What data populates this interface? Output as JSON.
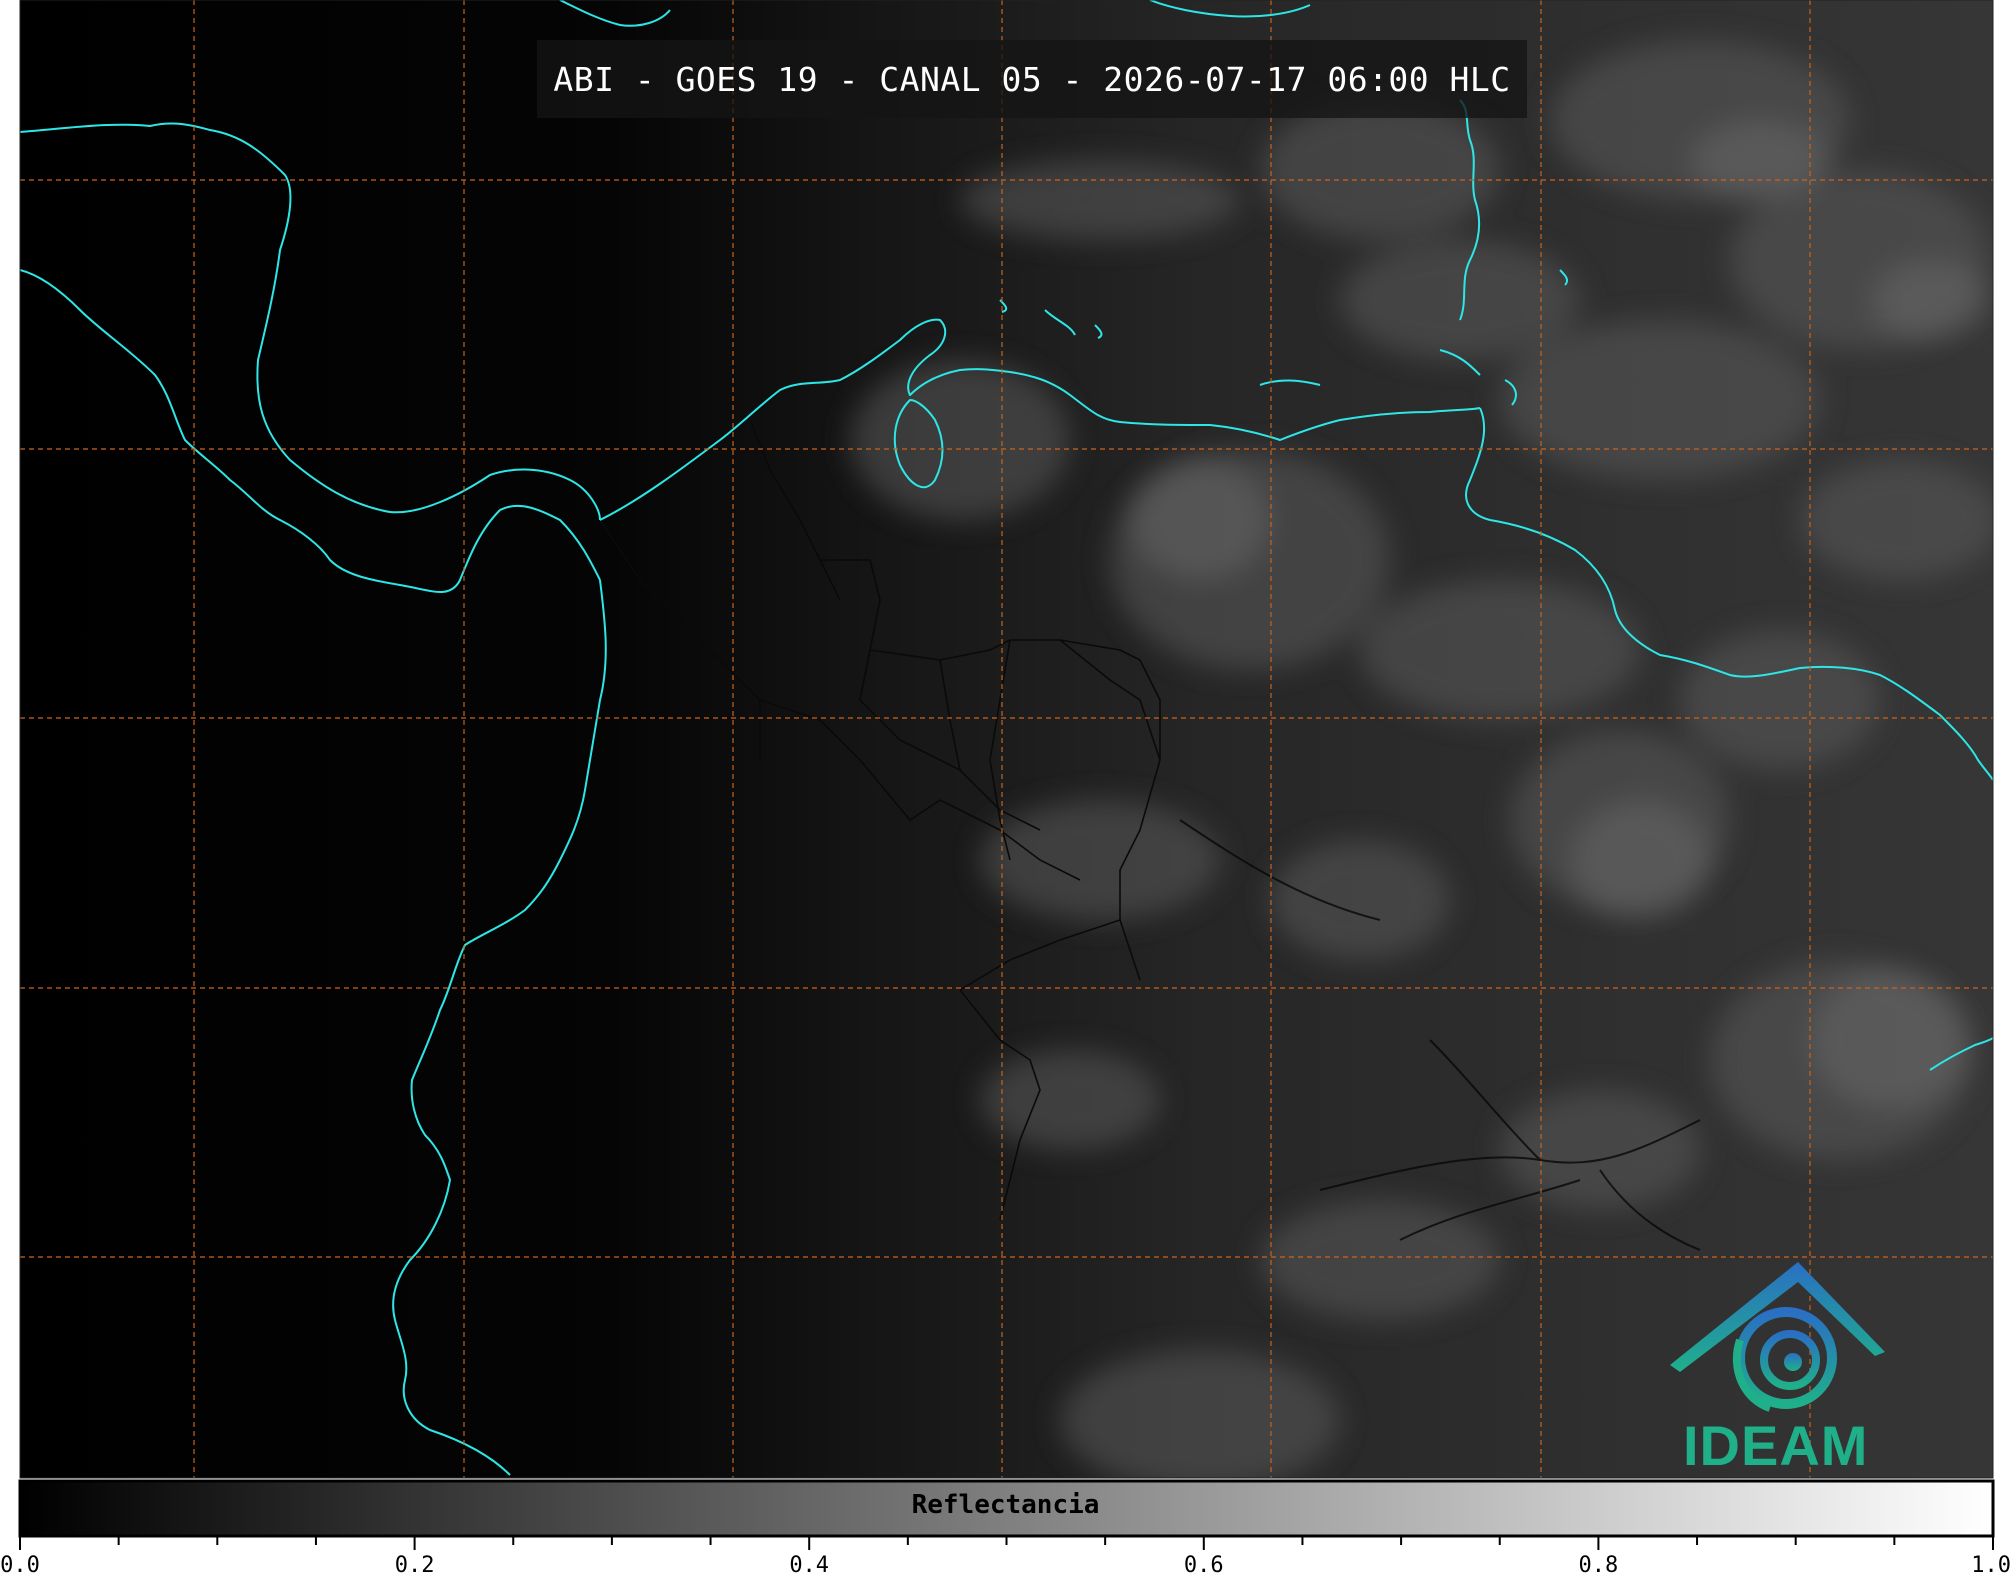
{
  "map": {
    "title": "ABI - GOES 19 - CANAL 05 - 2026-07-17 06:00 HLC",
    "grid": "on",
    "grid_color": "#c8641e",
    "coastline_color": "#2ee6e6",
    "border_color": "#0a0a0a",
    "background": "#000000"
  },
  "colorbar": {
    "label": "Reflectancia",
    "min": 0.0,
    "max": 1.0,
    "colormap": "greys (black to white)",
    "ticks": [
      "0.0",
      "0.2",
      "0.4",
      "0.6",
      "0.8",
      "1.0"
    ]
  },
  "logo": {
    "text": "IDEAM",
    "color_top": "#2a6fc4",
    "color_bottom": "#1fb08a"
  }
}
